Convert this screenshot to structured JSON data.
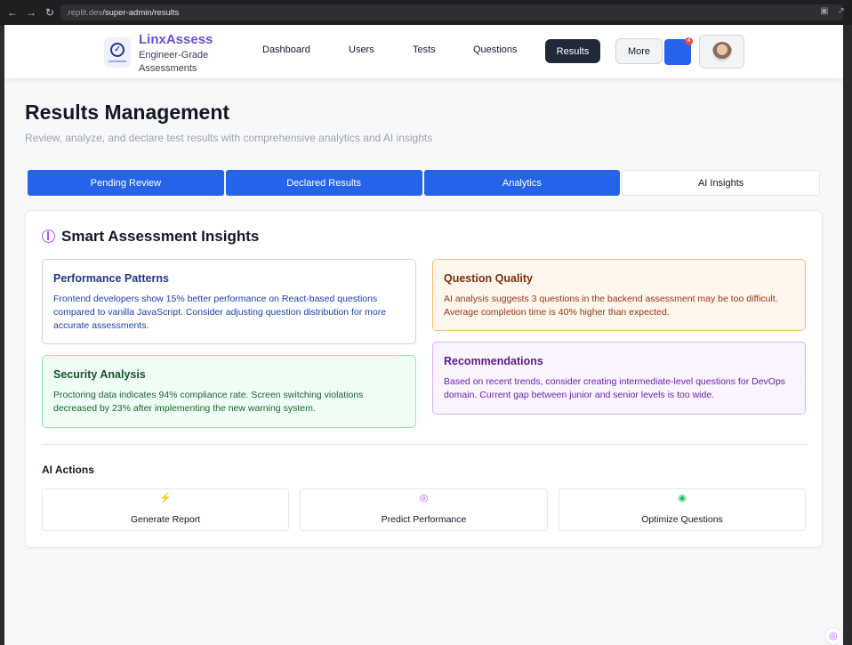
{
  "browser": {
    "url_host": ".replit.dev",
    "url_path": "/super-admin/results"
  },
  "header": {
    "logo_text": "LinxAssess",
    "brand_name": "LinxAssess",
    "brand_subtitle": "Engineer-Grade Assessments",
    "nav": [
      "Dashboard",
      "Users",
      "Tests",
      "Questions"
    ],
    "active_nav": "Results",
    "more_label": "More",
    "notification_count": "4"
  },
  "page": {
    "title": "Results Management",
    "description": "Review, analyze, and declare test results with comprehensive analytics and AI insights"
  },
  "tabs": [
    {
      "label": "Pending Review",
      "active": false
    },
    {
      "label": "Declared Results",
      "active": false
    },
    {
      "label": "Analytics",
      "active": false
    },
    {
      "label": "AI Insights",
      "active": true
    }
  ],
  "insights": {
    "title": "Smart Assessment Insights",
    "performance": {
      "title": "Performance Patterns",
      "text": "Frontend developers show 15% better performance on React-based questions compared to vanilla JavaScript. Consider adjusting question distribution for more accurate assessments."
    },
    "quality": {
      "title": "Question Quality",
      "text": "AI analysis suggests 3 questions in the backend assessment may be too difficult. Average completion time is 40% higher than expected."
    },
    "security": {
      "title": "Security Analysis",
      "text": "Proctoring data indicates 94% compliance rate. Screen switching violations decreased by 23% after implementing the new warning system."
    },
    "recommendations": {
      "title": "Recommendations",
      "text": "Based on recent trends, consider creating intermediate-level questions for DevOps domain. Current gap between junior and senior levels is too wide."
    }
  },
  "ai_actions": {
    "title": "AI Actions",
    "items": [
      {
        "label": "Generate Report",
        "icon": "lightning-icon"
      },
      {
        "label": "Predict Performance",
        "icon": "brain-icon"
      },
      {
        "label": "Optimize Questions",
        "icon": "target-icon"
      }
    ]
  },
  "colors": {
    "accent": "#2563eb",
    "brand": "#6d4ed6",
    "active_nav": "#1f2937"
  }
}
